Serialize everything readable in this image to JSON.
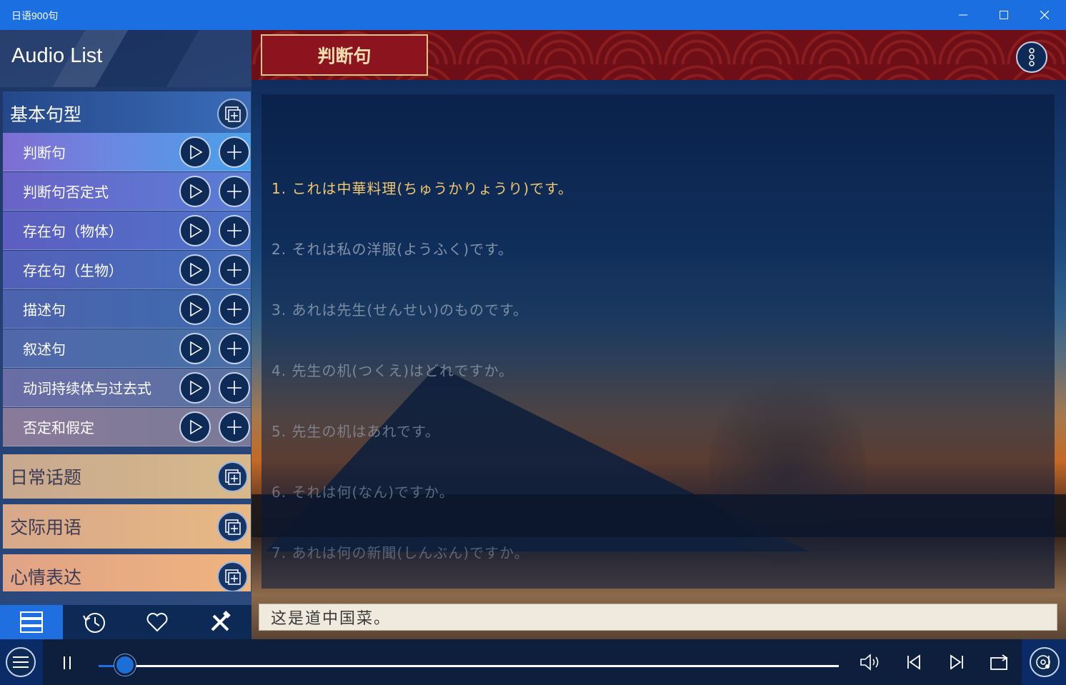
{
  "window": {
    "title": "日语900句",
    "minimize": "—",
    "maximize": "☐",
    "close": "✕"
  },
  "sidebar": {
    "title": "Audio List",
    "groups": [
      {
        "label": "基本句型",
        "items": [
          {
            "label": "判断句"
          },
          {
            "label": "判断句否定式"
          },
          {
            "label": "存在句（物体）"
          },
          {
            "label": "存在句（生物）"
          },
          {
            "label": "描述句"
          },
          {
            "label": "叙述句"
          },
          {
            "label": "动词持续体与过去式"
          },
          {
            "label": "否定和假定"
          }
        ]
      },
      {
        "label": "日常话题"
      },
      {
        "label": "交际用语"
      },
      {
        "label": "心情表达"
      }
    ],
    "nav": [
      {
        "name": "list-icon",
        "active": true
      },
      {
        "name": "history-icon",
        "active": false
      },
      {
        "name": "favorite-icon",
        "active": false
      },
      {
        "name": "tools-icon",
        "active": false
      }
    ]
  },
  "main": {
    "title": "判断句",
    "sentences": [
      "1. これは中華料理(ちゅうかりょうり)です。",
      "2. それは私の洋服(ようふく)です。",
      "3. あれは先生(せんせい)のものです。",
      "4. 先生の机(つくえ)はどれですか。",
      "5. 先生の机はあれです。",
      "6. それは何(なん)ですか。",
      "7. あれは何の新聞(しんぶん)ですか。"
    ],
    "active_index": 0,
    "translation": "这是道中国菜。",
    "colors": {
      "active": "#f2c66d",
      "inactive": "#9aa7b8",
      "banner": "#6e0f17"
    }
  },
  "player": {
    "state": "playing",
    "progress_fraction": 0.036
  }
}
